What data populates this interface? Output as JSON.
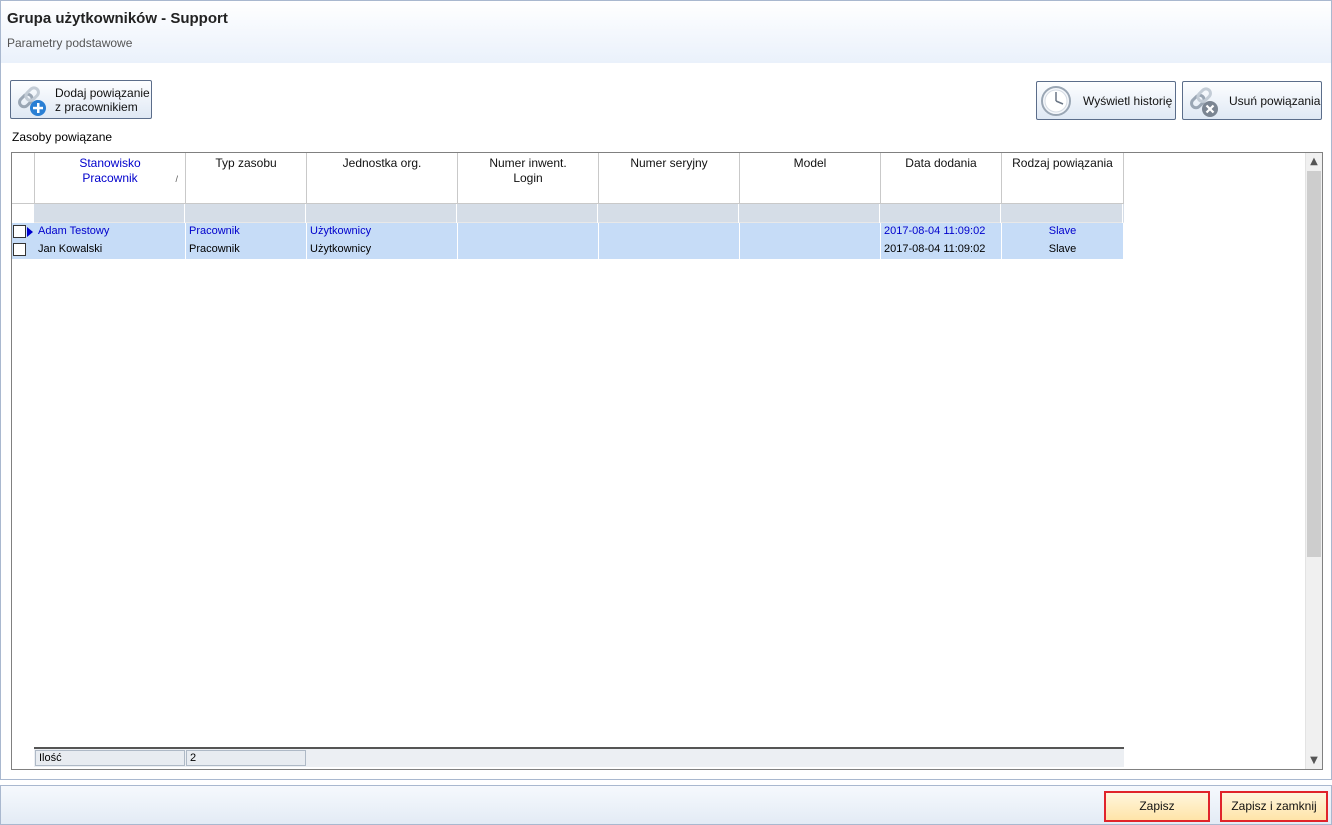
{
  "header": {
    "title": "Grupa użytkowników - Support",
    "subtitle": "Parametry podstawowe"
  },
  "toolbar": {
    "add_label_line1": "Dodaj powiązanie",
    "add_label_line2": "z pracownikiem",
    "history_label": "Wyświetl historię",
    "remove_label": "Usuń powiązania"
  },
  "section_label": "Zasoby powiązane",
  "grid": {
    "columns": [
      {
        "line1": "Stanowisko",
        "line2": "Pracownik",
        "sorted": true
      },
      {
        "line1": "Typ zasobu",
        "line2": ""
      },
      {
        "line1": "Jednostka org.",
        "line2": ""
      },
      {
        "line1": "Numer inwent.",
        "line2": "Login"
      },
      {
        "line1": "Numer seryjny",
        "line2": ""
      },
      {
        "line1": "Model",
        "line2": ""
      },
      {
        "line1": "Data dodania",
        "line2": ""
      },
      {
        "line1": "Rodzaj powiązania",
        "line2": ""
      }
    ],
    "sort_indicator": "/",
    "rows": [
      {
        "name": "Adam Testowy",
        "type": "Pracownik",
        "unit": "Użytkownicy",
        "inv": "",
        "serial": "",
        "model": "",
        "date": "2017-08-04 11:09:02",
        "relation": "Slave"
      },
      {
        "name": "Jan Kowalski",
        "type": "Pracownik",
        "unit": "Użytkownicy",
        "inv": "",
        "serial": "",
        "model": "",
        "date": "2017-08-04 11:09:02",
        "relation": "Slave"
      }
    ],
    "footer": {
      "label": "Ilość",
      "value": "2"
    }
  },
  "actions": {
    "save_label": "Zapisz",
    "save_close_label": "Zapisz i zamknij"
  }
}
